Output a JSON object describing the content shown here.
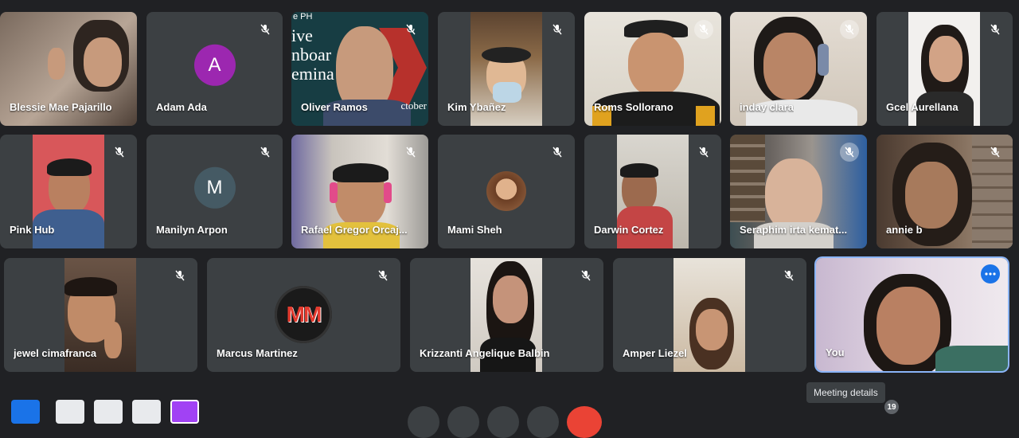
{
  "participants": {
    "p01": {
      "name": "Blessie Mae Pajarillo"
    },
    "p02": {
      "name": "Adam Ada",
      "initial": "A",
      "avatar_color": "#9c27b0"
    },
    "p03": {
      "name": "Oliver Ramos",
      "backdrop_text": "ive\nnboar\nemina",
      "backdrop_top": "e PH",
      "backdrop_side": "ctober"
    },
    "p04": {
      "name": "Kim Ybañez"
    },
    "p05": {
      "name": "Roms Sollorano"
    },
    "p06": {
      "name": "inday clara"
    },
    "p07": {
      "name": "Gcel Aurellana"
    },
    "p08": {
      "name": "Pink Hub"
    },
    "p09": {
      "name": "Manilyn Arpon",
      "initial": "M",
      "avatar_color": "#455a64"
    },
    "p10": {
      "name": "Rafael Gregor Orcaj..."
    },
    "p11": {
      "name": "Mami Sheh"
    },
    "p12": {
      "name": "Darwin Cortez"
    },
    "p13": {
      "name": "Seraphim irta kemat..."
    },
    "p14": {
      "name": "annie b"
    },
    "p15": {
      "name": "jewel cimafranca"
    },
    "p16": {
      "name": "Marcus Martinez",
      "logo_text": "MM"
    },
    "p17": {
      "name": "Krizzanti Angelique Balbin"
    },
    "p18": {
      "name": "Amper Liezel"
    },
    "p19": {
      "name": "You"
    }
  },
  "footer": {
    "tooltip": "Meeting details",
    "participant_count": "19"
  },
  "colors": {
    "background": "#202124",
    "tile": "#3c4043",
    "self_border": "#8ab4f8",
    "accent": "#1a73e8"
  },
  "icons": {
    "mic_off": "mic-off-icon",
    "more": "more-options-icon"
  }
}
